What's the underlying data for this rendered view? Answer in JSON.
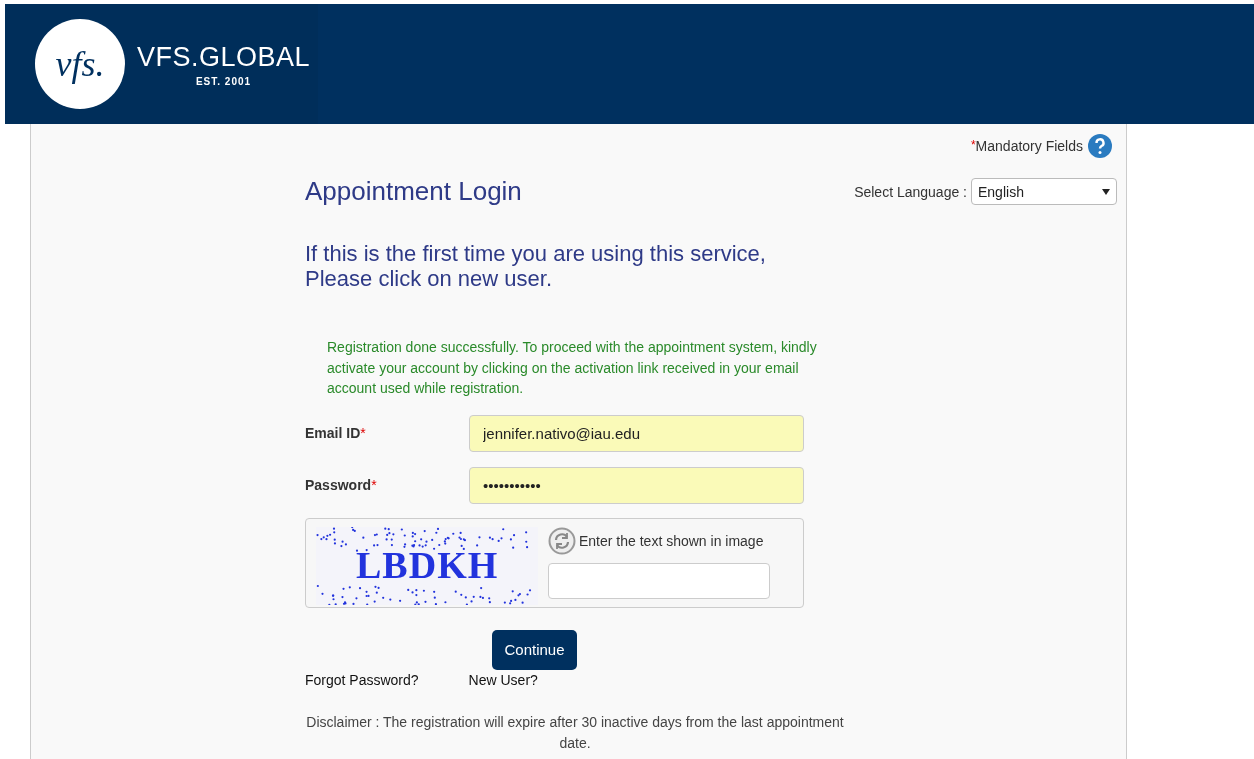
{
  "header": {
    "logo_mark": "vfs.",
    "brand": "VFS.GLOBAL",
    "established": "EST. 2001"
  },
  "mandatory_note": {
    "asterisk": "*",
    "label": "Mandatory Fields"
  },
  "title": "Appointment Login",
  "language": {
    "label": "Select Language :",
    "value": "English"
  },
  "intro": [
    "If this is the first time you are using this service,",
    "Please click on new user."
  ],
  "success_message": "Registration done successfully. To proceed with the appointment system, kindly activate your account by clicking on the activation link received in your email account used while registration.",
  "fields": [
    {
      "label": "Email ID",
      "required": true,
      "value": "jennifer.nativo@iau.edu"
    },
    {
      "label": "Password",
      "required": true,
      "value": "•••••••••••"
    }
  ],
  "captcha": {
    "image_text": "LBDKH",
    "prompt": "Enter the text shown in image"
  },
  "continue_button": "Continue",
  "links": [
    "Forgot Password?",
    "New User?"
  ],
  "disclaimer": "Disclaimer : The registration will expire after 30 inactive days from the last appointment date."
}
